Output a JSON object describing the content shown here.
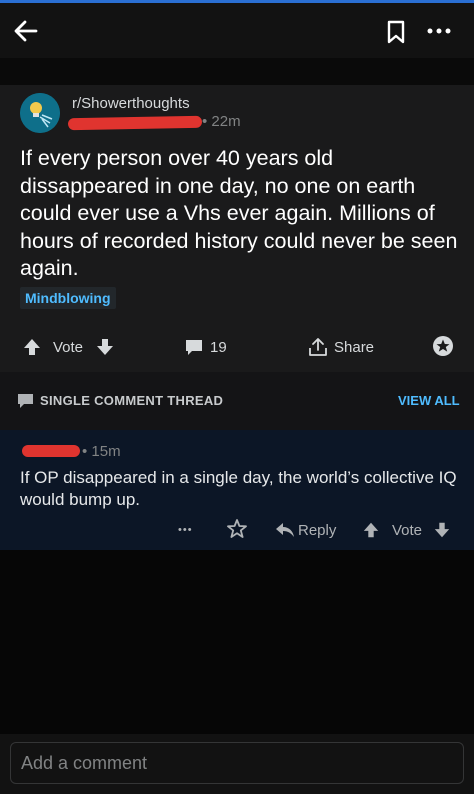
{
  "post": {
    "subreddit": "r/Showerthoughts",
    "time": "• 22m",
    "title": "If every person over 40 years old dissappeared in one day, no one on earth could ever use a Vhs ever again. Millions of hours of recorded history could never be seen again.",
    "flair": "Mindblowing",
    "vote_label": "Vote",
    "comment_count": "19",
    "share_label": "Share"
  },
  "thread": {
    "label": "SINGLE COMMENT THREAD",
    "view_all": "VIEW ALL"
  },
  "comment": {
    "time": "• 15m",
    "body": "If OP disappeared in a single day, the world’s collective IQ would bump up.",
    "more": "•••",
    "reply_label": "Reply",
    "vote_label": "Vote"
  },
  "composer": {
    "placeholder": "Add a comment"
  },
  "colors": {
    "accent": "#4fbcff",
    "redaction": "#e0342f",
    "top_line": "#2a6fd3"
  },
  "icons": [
    "back-arrow-icon",
    "bookmark-icon",
    "more-icon",
    "subreddit-avatar-icon",
    "upvote-icon",
    "downvote-icon",
    "comment-icon",
    "share-icon",
    "award-icon",
    "reply-icon",
    "chat-bubble-icon"
  ]
}
